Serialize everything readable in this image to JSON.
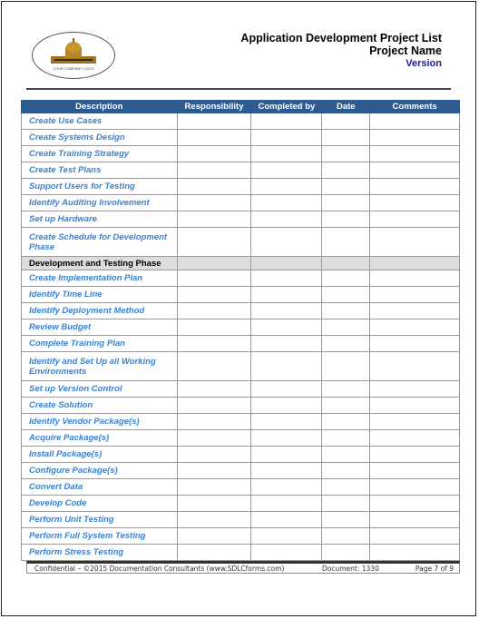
{
  "header": {
    "logo_text": "YOUR COMPANY LOGO",
    "title": "Application Development Project List",
    "project": "Project Name",
    "version": "Version"
  },
  "table": {
    "columns": [
      "Description",
      "Responsibility",
      "Completed by",
      "Date",
      "Comments"
    ],
    "rows": [
      {
        "text": "Create Use Cases"
      },
      {
        "text": "Create Systems Design"
      },
      {
        "text": "Create Training Strategy"
      },
      {
        "text": "Create Test Plans"
      },
      {
        "text": "Support Users for Testing"
      },
      {
        "text": "Identify Auditing Involvement"
      },
      {
        "text": "Set up Hardware"
      },
      {
        "text": "Create Schedule for Development Phase",
        "double": true
      },
      {
        "text": "Development and Testing Phase",
        "section": true
      },
      {
        "text": "Create Implementation Plan"
      },
      {
        "text": "Identify Time Line"
      },
      {
        "text": "Identify Deployment Method"
      },
      {
        "text": "Review Budget"
      },
      {
        "text": "Complete Training Plan"
      },
      {
        "text": "Identify and Set Up all Working Environments",
        "double": true
      },
      {
        "text": "Set up Version Control"
      },
      {
        "text": "Create Solution"
      },
      {
        "text": "Identify Vendor Package(s)"
      },
      {
        "text": "Acquire Package(s)"
      },
      {
        "text": "Install Package(s)"
      },
      {
        "text": "Configure Package(s)"
      },
      {
        "text": "Convert Data"
      },
      {
        "text": "Develop Code"
      },
      {
        "text": "Perform Unit Testing"
      },
      {
        "text": "Perform Full System Testing"
      },
      {
        "text": "Perform Stress Testing"
      }
    ]
  },
  "footer": {
    "copyright": "Confidential – ©2015 Documentation Consultants (www.SDLCforms.com)",
    "document": "Document: 1330",
    "page": "Page 7 of 9"
  }
}
